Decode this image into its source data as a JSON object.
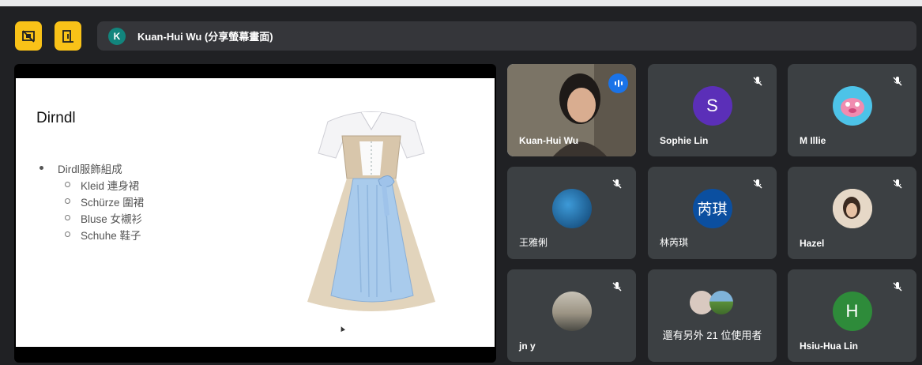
{
  "presenter": {
    "avatar_letter": "K",
    "label": "Kuan-Hui Wu (分享螢幕畫面)"
  },
  "slide": {
    "title": "Dirndl",
    "bullet": "Dirdl服飾組成",
    "sub_items": [
      "Kleid 連身裙",
      "Schürze 圍裙",
      "Bluse 女襯衫",
      "Schuhe 鞋子"
    ]
  },
  "participants": [
    {
      "name": "Kuan-Hui Wu",
      "type": "video",
      "speaking": true
    },
    {
      "name": "Sophie Lin",
      "avatar": "S",
      "avatar_color": "#5b2fb8",
      "muted": true
    },
    {
      "name": "M Illie",
      "avatar_color": "#4dc3e8",
      "muted": true
    },
    {
      "name": "王雅俐",
      "avatar_color": "#1b6da0",
      "muted": true
    },
    {
      "name": "林芮琪",
      "avatar": "芮琪",
      "avatar_color": "#0b4fa0",
      "muted": true
    },
    {
      "name": "Hazel",
      "avatar_color": "#c9b39a",
      "muted": true
    },
    {
      "name": "jn y",
      "avatar_color": "#8f8a7c",
      "muted": true
    },
    {
      "label": "還有另外 21 位使用者"
    },
    {
      "name": "Hsiu-Hua Lin",
      "avatar": "H",
      "avatar_color": "#2e8b3a",
      "muted": true
    }
  ]
}
